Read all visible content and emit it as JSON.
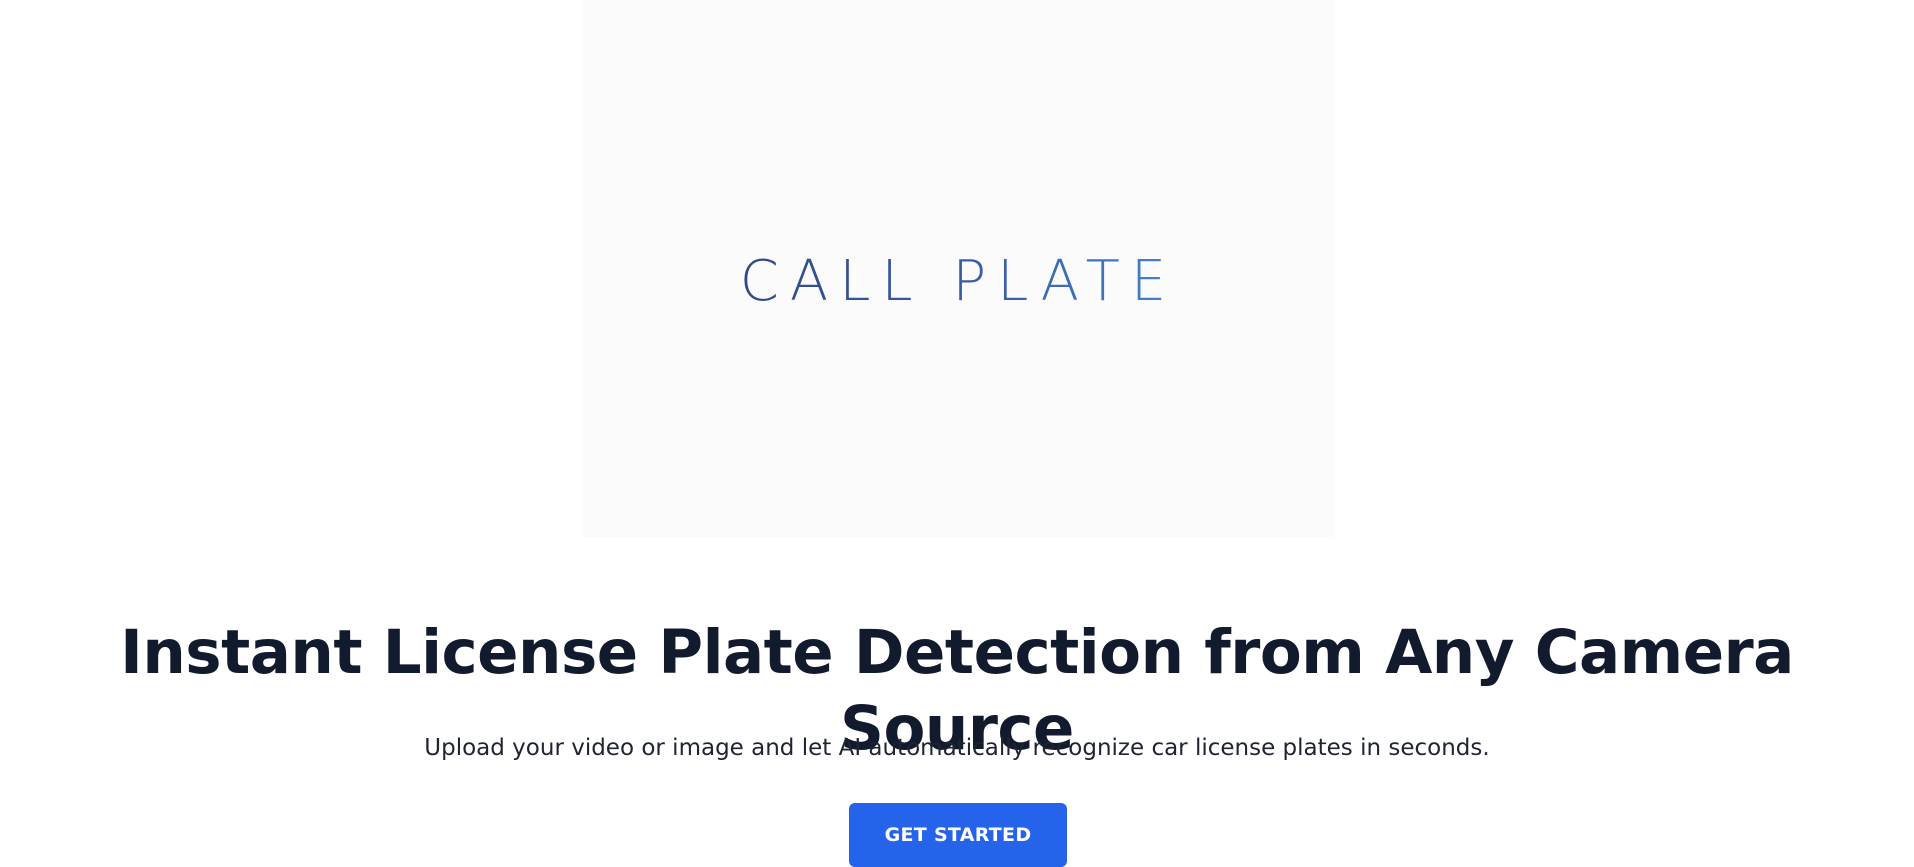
{
  "hero": {
    "logo_text": "CALL PLATE",
    "headline": "Instant License Plate Detection from Any Camera Source",
    "subtitle": "Upload your video or image and let AI automatically recognize car license plates in seconds.",
    "cta_label": "GET STARTED"
  },
  "colors": {
    "accent": "#2563eb",
    "headline": "#121a2e",
    "logo_dark": "#2d3a72",
    "logo_light": "#4aa3e8"
  }
}
